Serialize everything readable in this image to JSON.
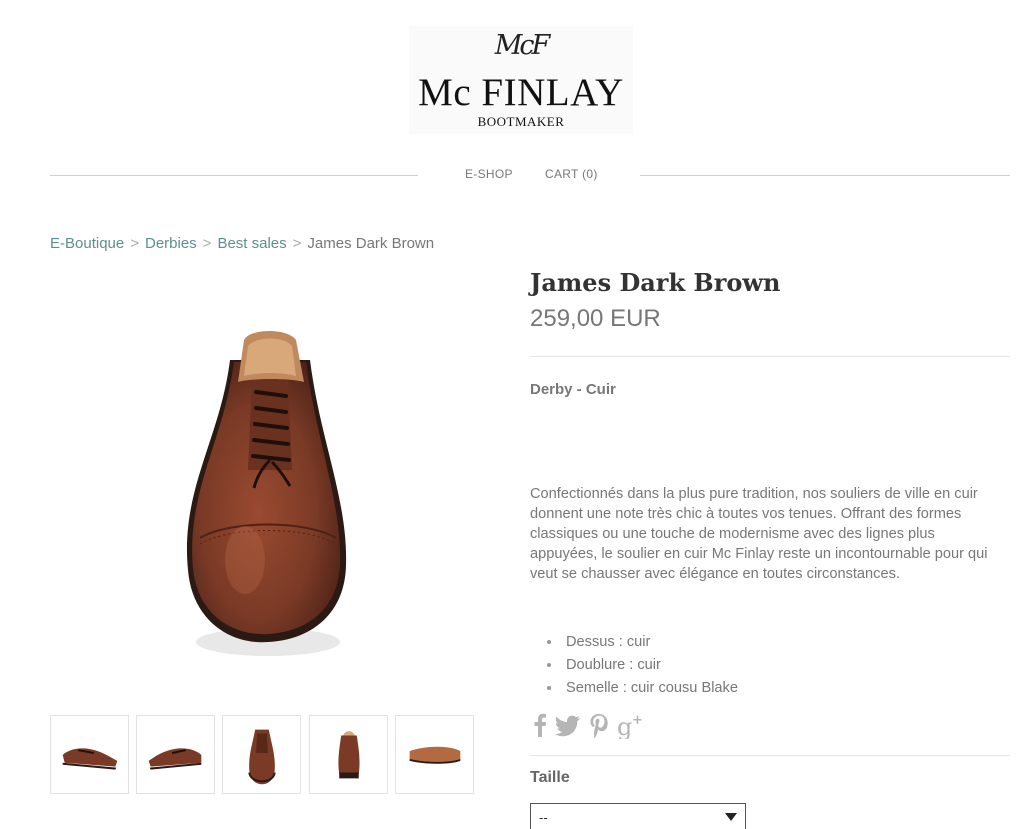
{
  "header": {
    "monogram": "McF",
    "brand": "Mc FINLAY",
    "tagline": "BOOTMAKER"
  },
  "nav": {
    "eshop": "E-SHOP",
    "cart": "CART (0)"
  },
  "breadcrumb": {
    "items": [
      "E-Boutique",
      "Derbies",
      "Best sales"
    ],
    "separator": ">",
    "current": "James Dark Brown"
  },
  "product": {
    "title": "James Dark Brown",
    "price": "259,00 EUR",
    "subtitle": "Derby - Cuir",
    "description": "Confectionnés dans la plus pure tradition, nos souliers de ville en cuir donnent une note très chic à toutes vos tenues. Offrant des formes classiques ou une touche de modernisme avec des lignes plus appuyées, le soulier en cuir Mc Finlay reste un incontournable pour qui veut se chausser avec élégance en toutes circonstances.",
    "features": [
      "Dessus : cuir",
      "Doublure : cuir",
      "Semelle : cuir cousu Blake"
    ],
    "size_label": "Taille",
    "size_value": "--"
  },
  "share_icons": [
    "facebook-icon",
    "twitter-icon",
    "pinterest-icon",
    "google-plus-icon"
  ],
  "colors": {
    "link": "#5d8f8f",
    "text": "#777777",
    "leather": "#7a3a26"
  }
}
